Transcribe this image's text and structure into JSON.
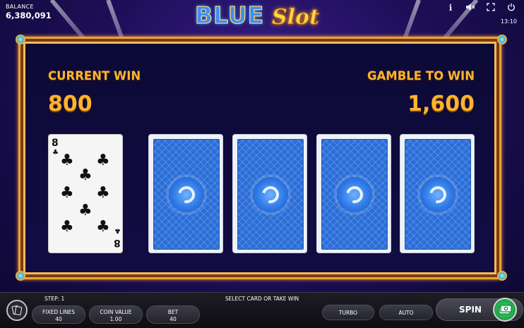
{
  "header": {
    "balance_label": "BALANCE",
    "balance_value": "6,380,091",
    "logo_part1": "BLUE",
    "logo_part2": "Slot",
    "clock": "13:10",
    "icons": [
      "info-icon",
      "mute-icon",
      "fullscreen-icon",
      "power-icon"
    ]
  },
  "gamble": {
    "current_win_label": "CURRENT WIN",
    "current_win_value": "800",
    "gamble_to_win_label": "GAMBLE TO WIN",
    "gamble_to_win_value": "1,600",
    "dealer_card": {
      "rank": "8",
      "suit": "clubs"
    },
    "face_down_cards": 4
  },
  "footer": {
    "step": "STEP: 1",
    "message": "SELECT CARD OR TAKE WIN",
    "fixed_lines_label": "FIXED LINES",
    "fixed_lines_value": "40",
    "coin_value_label": "COIN VALUE",
    "coin_value_value": "1.00",
    "bet_label": "BET",
    "bet_value": "40",
    "turbo_label": "TURBO",
    "auto_label": "AUTO",
    "spin_label": "SPIN"
  },
  "colors": {
    "accent_gold": "#ffb42a",
    "panel_border": "#e9a33a",
    "card_back_blue": "#2b6ed8",
    "collect_green": "#2ecc5f"
  }
}
